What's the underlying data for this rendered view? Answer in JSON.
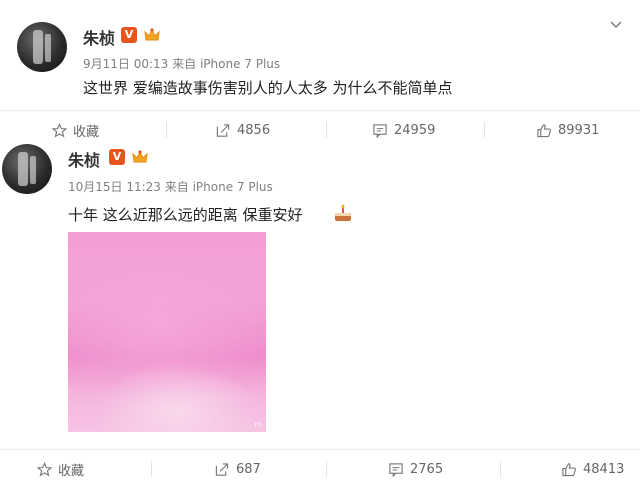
{
  "posts": [
    {
      "author": "朱桢",
      "date": "9月11日 00:13",
      "source": "来自 iPhone 7 Plus",
      "text": "这世界 爱编造故事伤害别人的人太多 为什么不能简单点",
      "actions": {
        "favorite_label": "收藏",
        "repost_count": "4856",
        "comment_count": "24959",
        "like_count": "89931"
      }
    },
    {
      "author": "朱桢",
      "date": "10月15日 11:23",
      "source": "来自 iPhone 7 Plus",
      "text": "十年 这么近那么远的距离 保重安好",
      "image_watermark": "m",
      "actions": {
        "favorite_label": "收藏",
        "repost_count": "687",
        "comment_count": "2765",
        "like_count": "48413"
      }
    }
  ],
  "colors": {
    "vip_badge": "#e8541e",
    "photo_pink": "#f49fd4",
    "meta_gray": "#808080"
  },
  "icons": [
    "star-icon",
    "repost-icon",
    "comment-icon",
    "like-icon",
    "chevron-down-icon",
    "crown-icon",
    "cake-emoji-icon"
  ]
}
